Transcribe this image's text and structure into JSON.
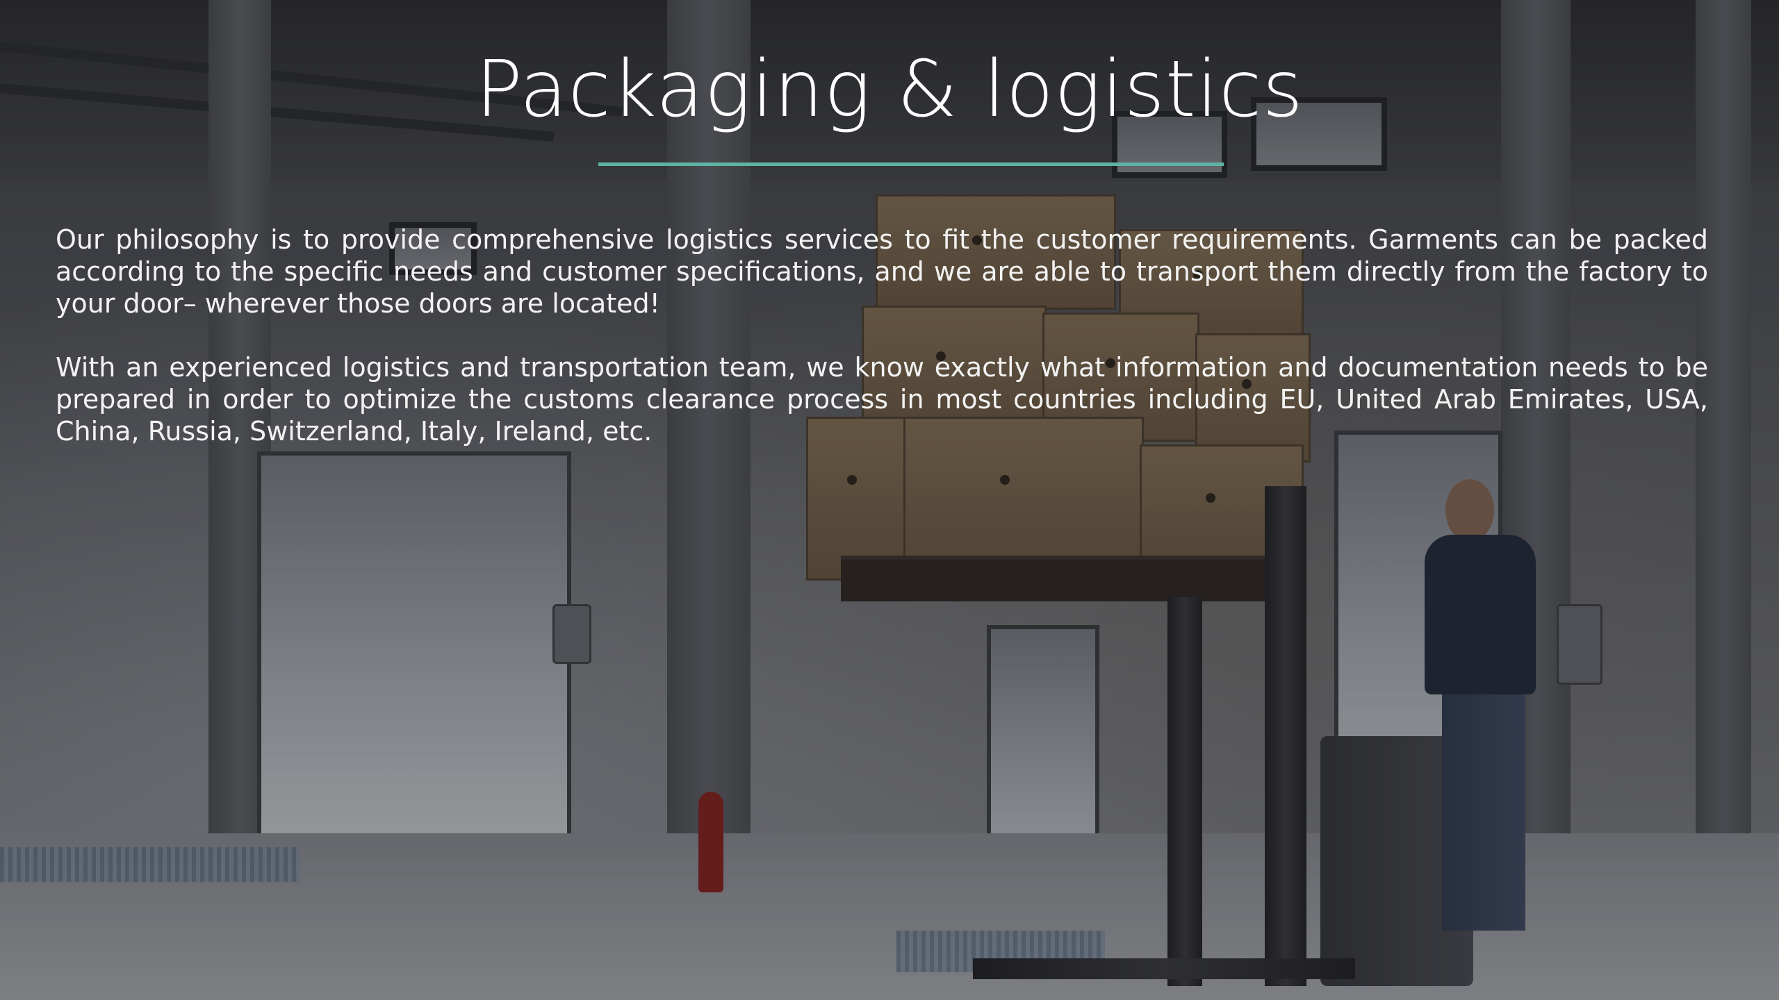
{
  "slide": {
    "title": "Packaging & logistics",
    "accent_color": "#5fb3a5",
    "paragraphs": [
      "Our philosophy is to provide comprehensive logistics services to fit the customer requirements. Garments can be packed according to the specific needs and customer specifications, and we are able to transport them directly from the factory to your door– wherever those doors are located!",
      "With an experienced logistics and transportation team, we know exactly what information and documentation needs to be prepared in order to optimize the customs clearance process in most countries including EU, United Arab Emirates, USA, China, Russia, Switzerland, Italy, Ireland, etc."
    ]
  },
  "background": {
    "image_subject": "warehouse loading dock with worker operating a pallet stacker carrying cardboard boxes",
    "icons": [
      "cardboard-box-icon",
      "fire-extinguisher-icon",
      "pallet-stacker-icon",
      "worker-icon"
    ]
  }
}
